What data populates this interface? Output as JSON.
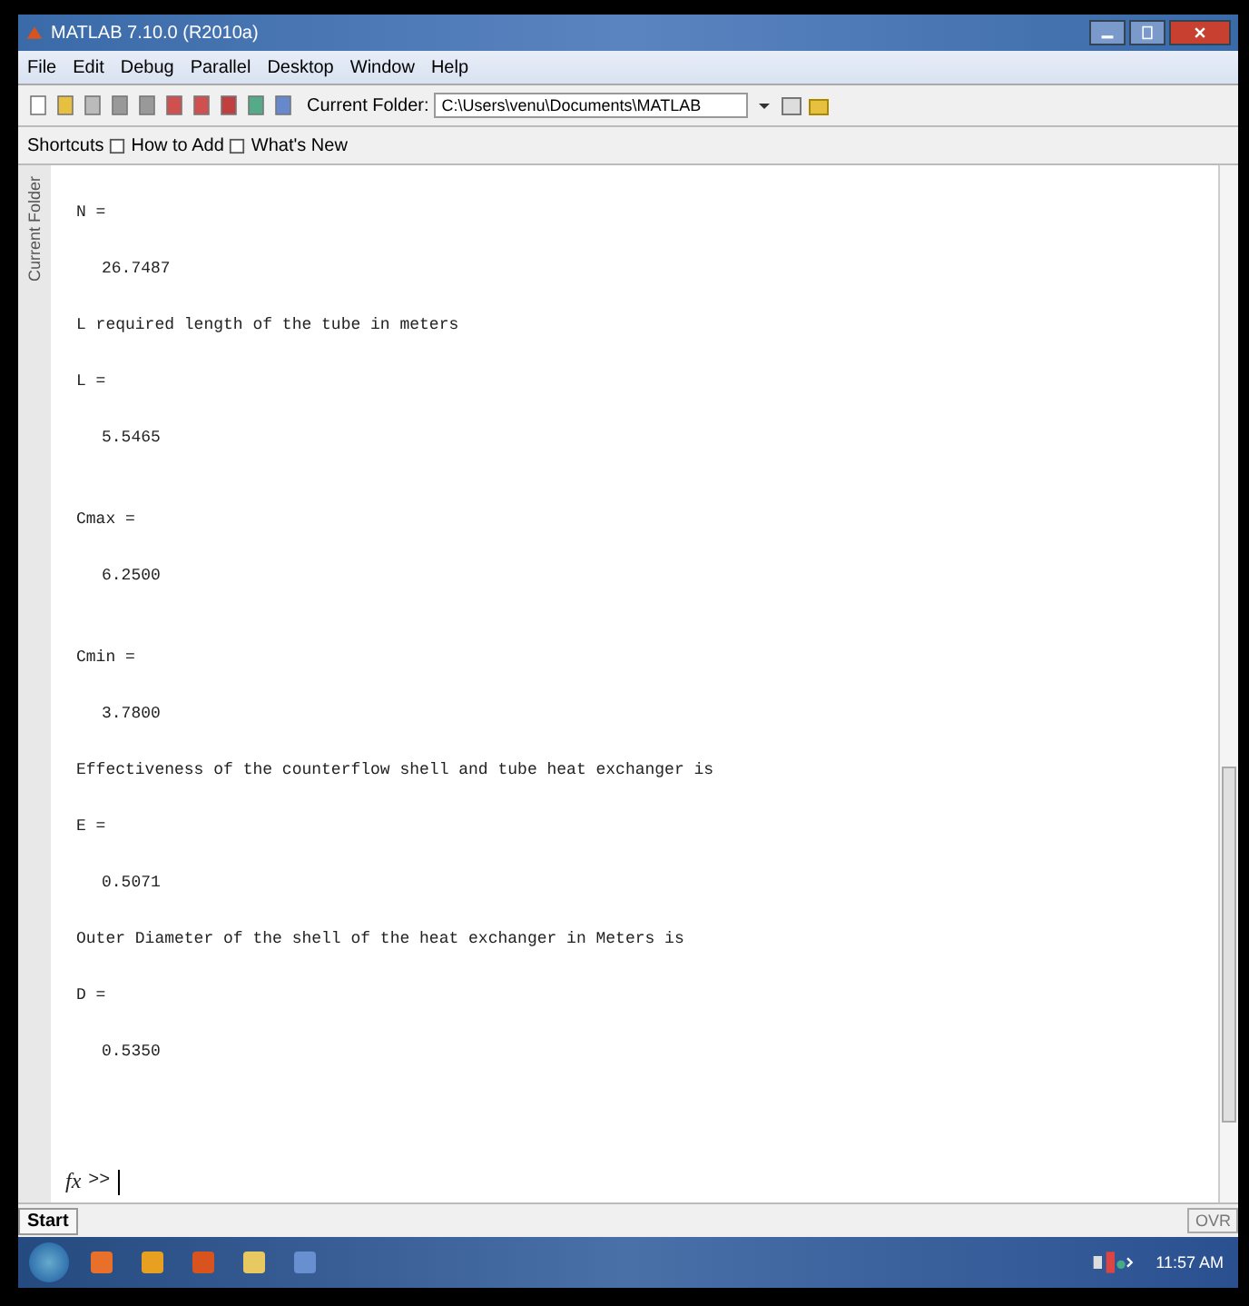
{
  "window": {
    "title": "MATLAB 7.10.0 (R2010a)"
  },
  "menu": [
    "File",
    "Edit",
    "Debug",
    "Parallel",
    "Desktop",
    "Window",
    "Help"
  ],
  "toolbar": {
    "folder_label": "Current Folder:",
    "folder_value": "C:\\Users\\venu\\Documents\\MATLAB"
  },
  "shortcuts": [
    "Shortcuts",
    "How to Add",
    "What's New"
  ],
  "side_tab": "Current Folder",
  "console": [
    {
      "kind": "var",
      "text": "N ="
    },
    {
      "kind": "value",
      "text": "26.7487"
    },
    {
      "kind": "message",
      "text": "L required length of the tube in meters"
    },
    {
      "kind": "var",
      "text": "L ="
    },
    {
      "kind": "value",
      "text": "5.5465"
    },
    {
      "kind": "var",
      "text": "Cmax ="
    },
    {
      "kind": "value",
      "text": "6.2500"
    },
    {
      "kind": "var",
      "text": "Cmin ="
    },
    {
      "kind": "value",
      "text": "3.7800"
    },
    {
      "kind": "message",
      "text": "Effectiveness of the counterflow shell and tube heat exchanger is"
    },
    {
      "kind": "var",
      "text": "E ="
    },
    {
      "kind": "value",
      "text": "0.5071"
    },
    {
      "kind": "message",
      "text": "Outer Diameter of the shell of the heat exchanger in Meters is"
    },
    {
      "kind": "var",
      "text": "D ="
    },
    {
      "kind": "value",
      "text": "0.5350"
    }
  ],
  "prompt": {
    "fx": "fx",
    "symbol": ">>"
  },
  "status_bar": {
    "start": "Start",
    "mode": "OVR"
  },
  "taskbar": {
    "clock": "11:57 AM"
  }
}
